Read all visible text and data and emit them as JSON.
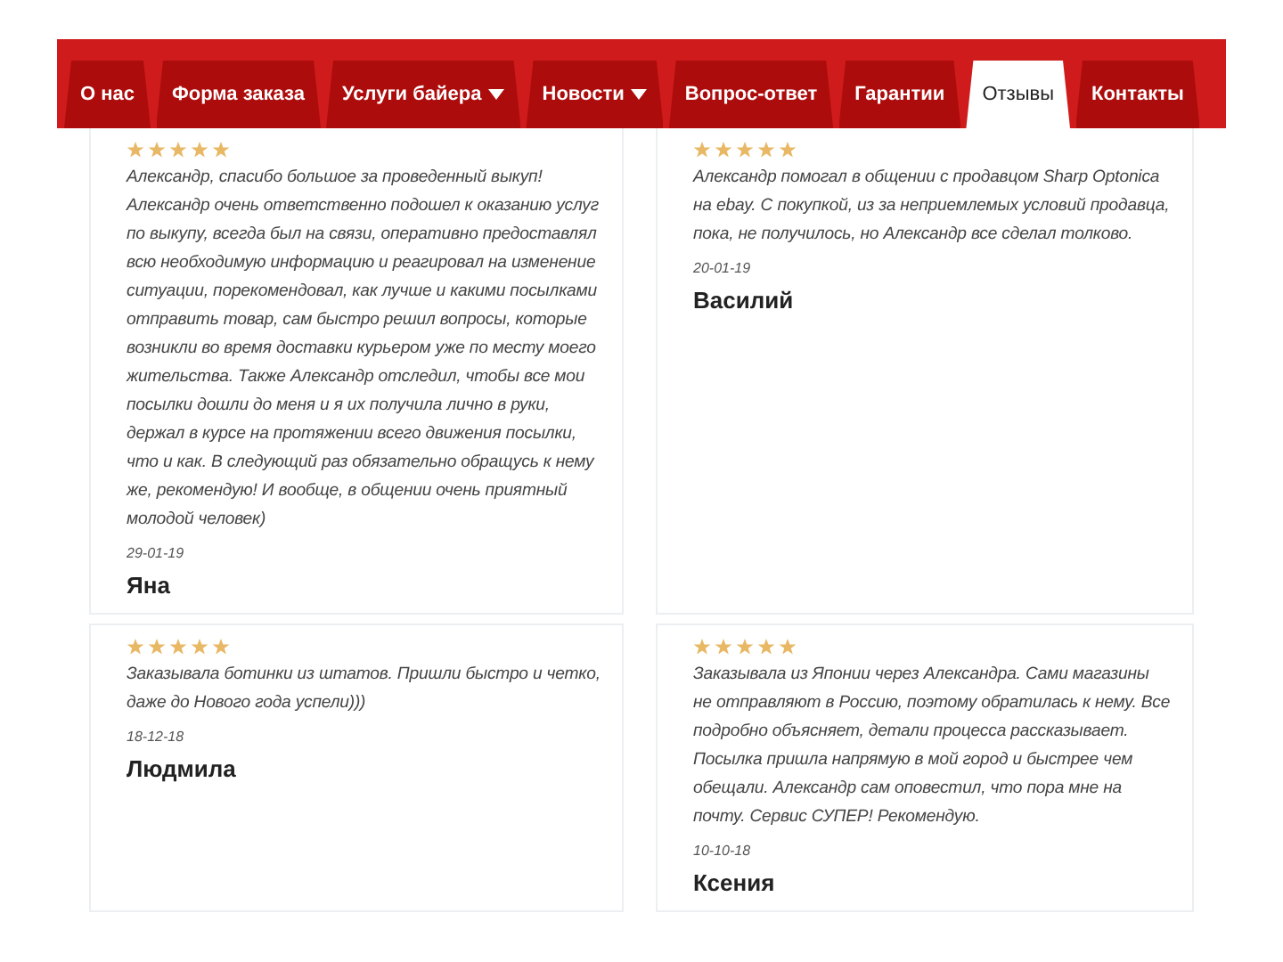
{
  "nav": {
    "tabs": [
      {
        "label": "О нас",
        "selected": false,
        "dropdown": false
      },
      {
        "label": "Форма заказа",
        "selected": false,
        "dropdown": false
      },
      {
        "label": "Услуги байера",
        "selected": false,
        "dropdown": true
      },
      {
        "label": "Новости",
        "selected": false,
        "dropdown": true
      },
      {
        "label": "Вопрос-ответ",
        "selected": false,
        "dropdown": false
      },
      {
        "label": "Гарантии",
        "selected": false,
        "dropdown": false
      },
      {
        "label": "Отзывы",
        "selected": true,
        "dropdown": false
      },
      {
        "label": "Контакты",
        "selected": false,
        "dropdown": false
      }
    ]
  },
  "reviews": [
    {
      "stars": 5,
      "text": "Александр, спасибо большое за проведенный выкуп! Александр очень ответственно подошел к оказанию услуг по выкупу, всегда был на связи, оперативно предоставлял всю необходимую информацию и реагировал на изменение ситуации, порекомендовал, как лучше и какими посылками отправить товар, сам быстро решил вопросы, которые возникли во время доставки курьером уже по месту моего жительства. Также Александр отследил, чтобы все мои посылки дошли до меня и я их получила лично в руки, держал в курсе на протяжении всего движения посылки, что и как. В следующий раз обязательно обращусь к нему же, рекомендую! И вообще, в общении очень приятный молодой человек)",
      "date": "29-01-19",
      "author": "Яна"
    },
    {
      "stars": 5,
      "text": "Александр помогал в общении с продавцом Sharp Optonica на ebay. С покупкой, из за неприемлемых условий продавца, пока, не получилось, но Александр все сделал толково.",
      "date": "20-01-19",
      "author": "Василий"
    },
    {
      "stars": 5,
      "text": "Заказывала ботинки из штатов. Пришли быстро и четко, даже до Нового года успели)))",
      "date": "18-12-18",
      "author": "Людмила"
    },
    {
      "stars": 5,
      "text": "Заказывала из Японии через Александра. Сами магазины не отправляют в Россию, поэтому обратилась к нему. Все подробно объясняет, детали процесса рассказывает. Посылка пришла напрямую в мой город и быстрее чем обещали. Александр сам оповестил, что пора мне на почту. Сервис СУПЕР! Рекомендую.",
      "date": "10-10-18",
      "author": "Ксения"
    }
  ]
}
